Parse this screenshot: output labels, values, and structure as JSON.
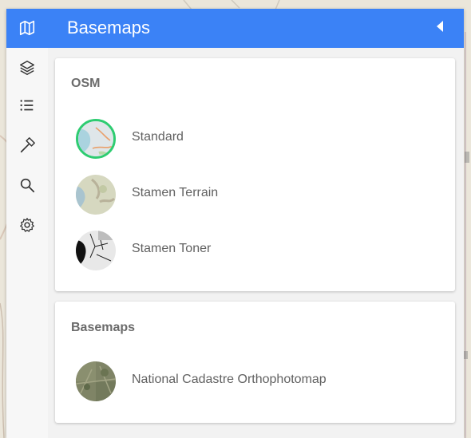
{
  "header": {
    "title": "Basemaps"
  },
  "sidebar": {
    "items": [
      {
        "icon": "layers-icon"
      },
      {
        "icon": "list-icon"
      },
      {
        "icon": "hammer-icon"
      },
      {
        "icon": "search-icon"
      },
      {
        "icon": "gear-icon"
      }
    ]
  },
  "groups": [
    {
      "title": "OSM",
      "items": [
        {
          "label": "Standard",
          "selected": true
        },
        {
          "label": "Stamen Terrain",
          "selected": false
        },
        {
          "label": "Stamen Toner",
          "selected": false
        }
      ]
    },
    {
      "title": "Basemaps",
      "items": [
        {
          "label": "National Cadastre Orthophotomap",
          "selected": false
        }
      ]
    }
  ],
  "colors": {
    "accent": "#3b82f6",
    "selected_border": "#2ecc71"
  }
}
